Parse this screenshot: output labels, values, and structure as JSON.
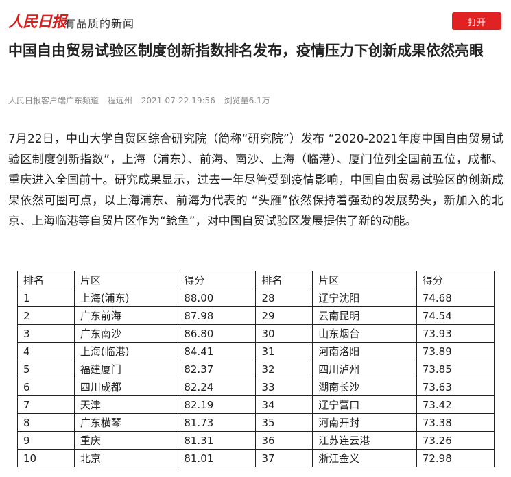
{
  "header": {
    "logo_text": "人民日报",
    "slogan": "有品质的新闻",
    "open_button": "打开"
  },
  "article": {
    "title": "中国自由贸易试验区制度创新指数排名发布，疫情压力下创新成果依然亮眼",
    "meta": {
      "source": "人民日报客户端广东频道",
      "author": "程远州",
      "datetime": "2021-07-22 19:56",
      "views": "浏览量6.1万"
    },
    "paragraph": "7月22日，中山大学自贸区综合研究院（简称“研究院”）发布 “2020-2021年度中国自由贸易试验区制度创新指数”，上海（浦东）、前海、南沙、上海（临港）、厦门位列全国前五位，成都、重庆进入全国前十。研究成果显示，过去一年尽管受到疫情影响，中国自由贸易试验区的创新成果依然可圈可点，以上海浦东、前海为代表的 “头雁”依然保持着强劲的发展势头，新加入的北京、上海临港等自贸片区作为“鲶鱼”，对中国自贸试验区发展提供了新的动能。"
  },
  "table": {
    "headers": [
      "排名",
      "片区",
      "得分",
      "排名",
      "片区",
      "得分"
    ],
    "rows": [
      [
        "1",
        "上海(浦东)",
        "88.00",
        "28",
        "辽宁沈阳",
        "74.68"
      ],
      [
        "2",
        "广东前海",
        "87.98",
        "29",
        "云南昆明",
        "74.54"
      ],
      [
        "3",
        "广东南沙",
        "86.80",
        "30",
        "山东烟台",
        "73.93"
      ],
      [
        "4",
        "上海(临港)",
        "84.41",
        "31",
        "河南洛阳",
        "73.89"
      ],
      [
        "5",
        "福建厦门",
        "82.37",
        "32",
        "四川泸州",
        "73.85"
      ],
      [
        "6",
        "四川成都",
        "82.24",
        "33",
        "湖南长沙",
        "73.63"
      ],
      [
        "7",
        "天津",
        "82.19",
        "34",
        "辽宁营口",
        "73.42"
      ],
      [
        "8",
        "广东横琴",
        "81.73",
        "35",
        "河南开封",
        "73.38"
      ],
      [
        "9",
        "重庆",
        "81.31",
        "36",
        "江苏连云港",
        "73.26"
      ],
      [
        "10",
        "北京",
        "81.01",
        "37",
        "浙江金义",
        "72.98"
      ]
    ]
  },
  "colors": {
    "brand_red": "#d9201f",
    "button_red": "#e02222"
  }
}
